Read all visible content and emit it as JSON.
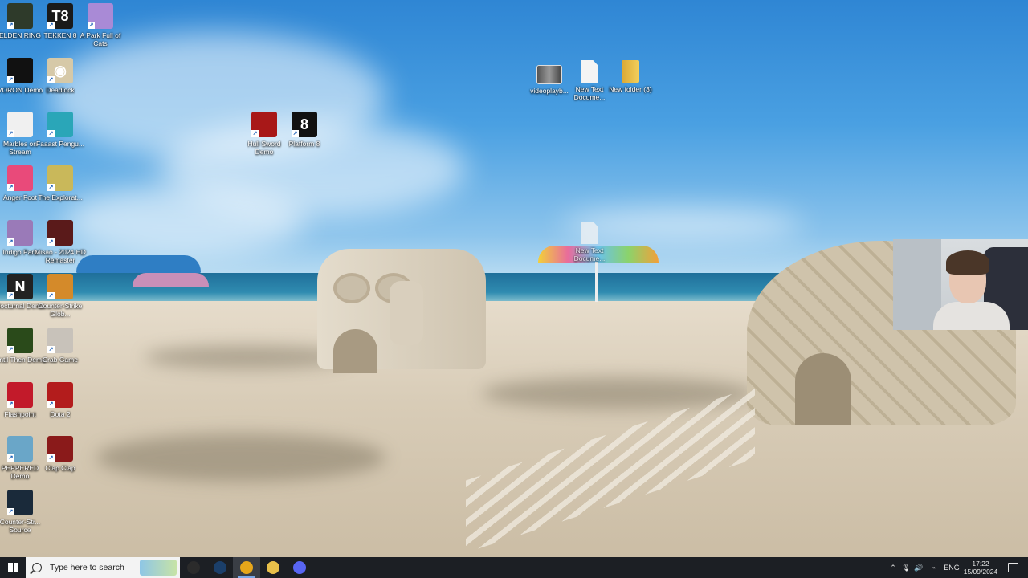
{
  "desktop": {
    "icons_left": [
      {
        "label": "ELDEN RING",
        "icon": "elden-ring-icon",
        "glyph": "",
        "color": "#2e3a2a"
      },
      {
        "label": "TEKKEN 8",
        "icon": "tekken-8-icon",
        "glyph": "T8",
        "color": "#1a1a1a"
      },
      {
        "label": "A Park Full of Cats",
        "icon": "park-cats-icon",
        "glyph": "",
        "color": "#a98ad6"
      },
      {
        "label": "VORON Demo",
        "icon": "voron-icon",
        "glyph": "",
        "color": "#111111"
      },
      {
        "label": "Deadlock",
        "icon": "deadlock-icon",
        "glyph": "◉",
        "color": "#d6c9a8"
      },
      {
        "label": "Marbles on Stream",
        "icon": "marbles-icon",
        "glyph": "",
        "color": "#f0f0f0"
      },
      {
        "label": "Faaast Pengu...",
        "icon": "penguin-icon",
        "glyph": "",
        "color": "#2aa6b8"
      },
      {
        "label": "Anger Foot",
        "icon": "anger-foot-icon",
        "glyph": "",
        "color": "#e94a7a"
      },
      {
        "label": "The Explorat...",
        "icon": "exploration-icon",
        "glyph": "",
        "color": "#c9b85a"
      },
      {
        "label": "Indigo Park",
        "icon": "indigo-park-icon",
        "glyph": "",
        "color": "#9a7ab8"
      },
      {
        "label": "Misao - 2024 HD Remaster",
        "icon": "misao-icon",
        "glyph": "",
        "color": "#5a1a1a"
      },
      {
        "label": "Nocturnal Demo",
        "icon": "nocturnal-icon",
        "glyph": "N",
        "color": "#222222"
      },
      {
        "label": "Counter-Strike Glob...",
        "icon": "csgo-icon",
        "glyph": "",
        "color": "#d48a2a"
      },
      {
        "label": "Until Then Demo",
        "icon": "until-then-icon",
        "glyph": "",
        "color": "#2a4a1a"
      },
      {
        "label": "Crab Game",
        "icon": "crab-game-icon",
        "glyph": "",
        "color": "#c8c2ba"
      },
      {
        "label": "Flashpoint",
        "icon": "flashpoint-icon",
        "glyph": "",
        "color": "#c21a2a"
      },
      {
        "label": "Dota 2",
        "icon": "dota2-icon",
        "glyph": "",
        "color": "#b31c1c"
      },
      {
        "label": "PEPPERED Demo",
        "icon": "peppered-icon",
        "glyph": "",
        "color": "#6aa6c8"
      },
      {
        "label": "Clap Clap",
        "icon": "clap-clap-icon",
        "glyph": "",
        "color": "#8a1a1a"
      },
      {
        "label": "Counter-Str... Source",
        "icon": "cs-source-icon",
        "glyph": "",
        "color": "#1a2a3a"
      }
    ],
    "icons_middle": [
      {
        "label": "Hull Sword Demo",
        "icon": "hull-sword-icon",
        "glyph": "",
        "color": "#a81818"
      },
      {
        "label": "Platform 8",
        "icon": "platform-8-icon",
        "glyph": "8",
        "color": "#111111"
      }
    ],
    "icons_files": [
      {
        "label": "videoplayb...",
        "icon": "video-file-icon"
      },
      {
        "label": "New Text Docume...",
        "icon": "text-document-icon"
      },
      {
        "label": "New folder (3)",
        "icon": "folder-icon"
      }
    ],
    "dragging_file": {
      "label": "New Text Docume...",
      "icon": "text-document-icon"
    }
  },
  "taskbar": {
    "search_placeholder": "Type here to search",
    "apps": [
      {
        "icon": "obs-icon",
        "color": "#2b2b2b"
      },
      {
        "icon": "steam-icon",
        "color": "#1b3f6a"
      },
      {
        "icon": "chrome-icon",
        "color": "#e6a61a",
        "active": true
      },
      {
        "icon": "file-explorer-icon",
        "color": "#e8c04a"
      },
      {
        "icon": "discord-icon",
        "color": "#5865f2"
      }
    ],
    "tray": {
      "language": "ENG",
      "time": "17:22",
      "date": "15/09/2024"
    }
  },
  "colors": {
    "taskbar_bg": "#1c1f24",
    "search_bg": "#f3f3f3"
  }
}
